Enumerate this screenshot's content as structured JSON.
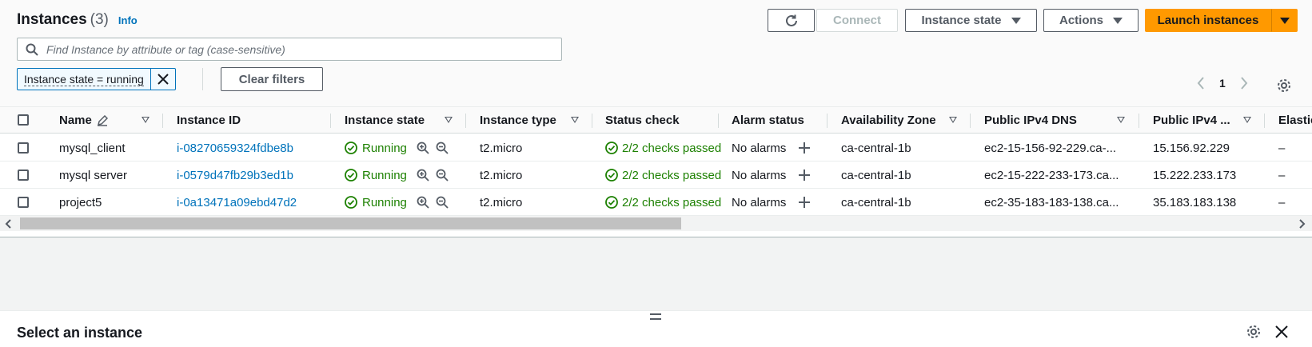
{
  "header": {
    "title": "Instances",
    "count": "(3)",
    "info_label": "Info",
    "connect_label": "Connect",
    "instance_state_label": "Instance state",
    "actions_label": "Actions",
    "launch_label": "Launch instances"
  },
  "search": {
    "placeholder": "Find Instance by attribute or tag (case-sensitive)"
  },
  "filters": {
    "token_label": "Instance state = running",
    "clear_label": "Clear filters"
  },
  "pagination": {
    "current_page": "1"
  },
  "table": {
    "columns": [
      "Name",
      "Instance ID",
      "Instance state",
      "Instance type",
      "Status check",
      "Alarm status",
      "Availability Zone",
      "Public IPv4 DNS",
      "Public IPv4 ...",
      "Elastic"
    ],
    "rows": [
      {
        "name": "mysql_client",
        "instance_id": "i-08270659324fdbe8b",
        "state": "Running",
        "type": "t2.micro",
        "status_check": "2/2 checks passed",
        "alarm_status": "No alarms",
        "zone": "ca-central-1b",
        "dns": "ec2-15-156-92-229.ca-...",
        "ipv4": "15.156.92.229",
        "elastic": "–"
      },
      {
        "name": "mysql server",
        "instance_id": "i-0579d47fb29b3ed1b",
        "state": "Running",
        "type": "t2.micro",
        "status_check": "2/2 checks passed",
        "alarm_status": "No alarms",
        "zone": "ca-central-1b",
        "dns": "ec2-15-222-233-173.ca...",
        "ipv4": "15.222.233.173",
        "elastic": "–"
      },
      {
        "name": "project5",
        "instance_id": "i-0a13471a09ebd47d2",
        "state": "Running",
        "type": "t2.micro",
        "status_check": "2/2 checks passed",
        "alarm_status": "No alarms",
        "zone": "ca-central-1b",
        "dns": "ec2-35-183-183-138.ca...",
        "ipv4": "35.183.183.138",
        "elastic": "–"
      }
    ]
  },
  "details_panel": {
    "title": "Select an instance"
  },
  "colors": {
    "primary": "#ff9900",
    "link": "#0073bb",
    "success": "#1d8102",
    "text": "#16191f"
  }
}
